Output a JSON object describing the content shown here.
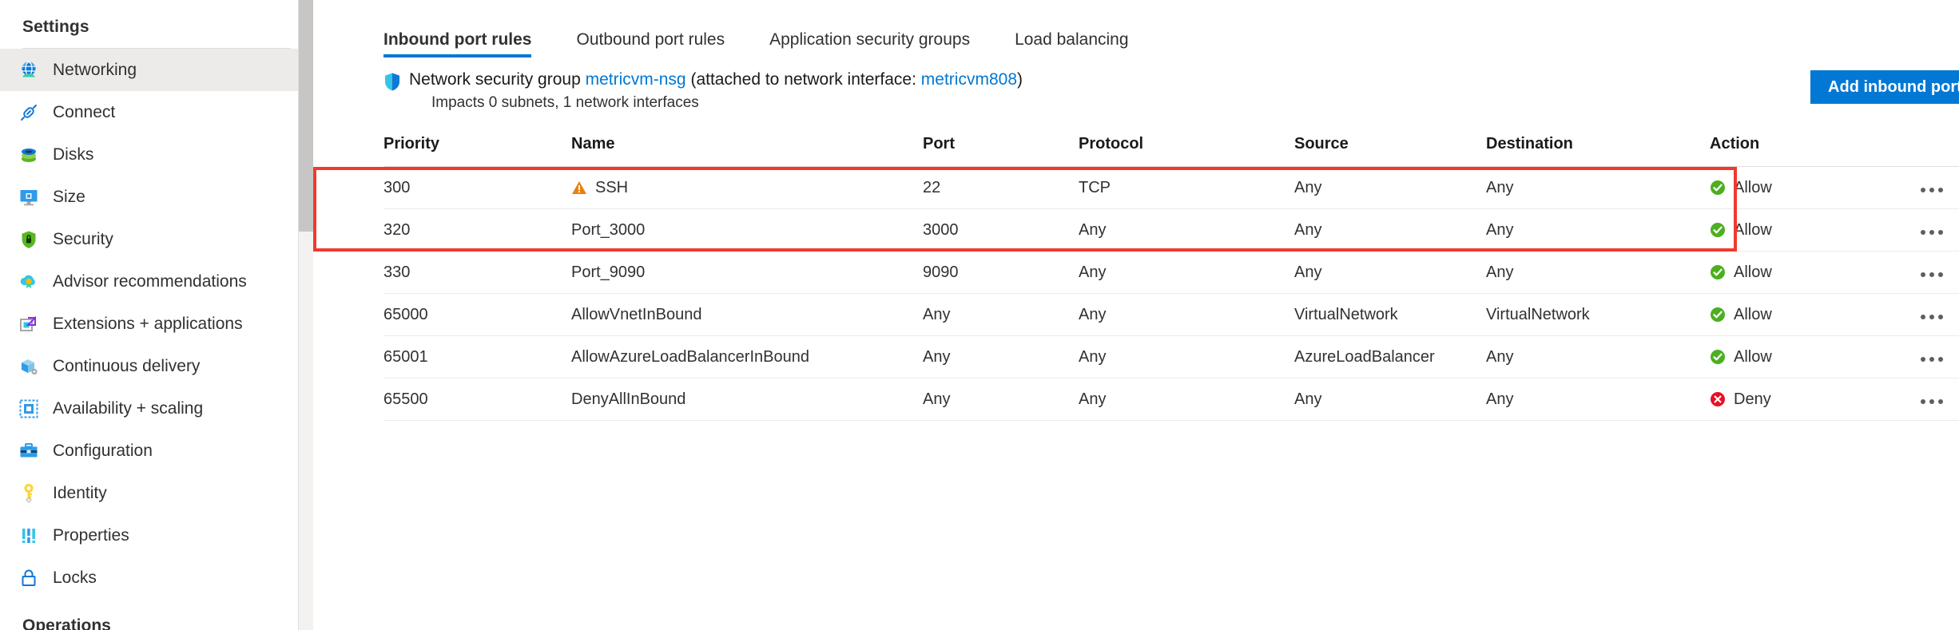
{
  "sidebar": {
    "title": "Settings",
    "items": [
      {
        "label": "Networking",
        "icon": "networking-icon",
        "selected": true
      },
      {
        "label": "Connect",
        "icon": "connect-icon",
        "selected": false
      },
      {
        "label": "Disks",
        "icon": "disks-icon",
        "selected": false
      },
      {
        "label": "Size",
        "icon": "size-icon",
        "selected": false
      },
      {
        "label": "Security",
        "icon": "security-shield-icon",
        "selected": false
      },
      {
        "label": "Advisor recommendations",
        "icon": "advisor-icon",
        "selected": false
      },
      {
        "label": "Extensions + applications",
        "icon": "extensions-icon",
        "selected": false
      },
      {
        "label": "Continuous delivery",
        "icon": "continuous-delivery-icon",
        "selected": false
      },
      {
        "label": "Availability + scaling",
        "icon": "availability-scaling-icon",
        "selected": false
      },
      {
        "label": "Configuration",
        "icon": "configuration-icon",
        "selected": false
      },
      {
        "label": "Identity",
        "icon": "identity-key-icon",
        "selected": false
      },
      {
        "label": "Properties",
        "icon": "properties-icon",
        "selected": false
      },
      {
        "label": "Locks",
        "icon": "lock-icon",
        "selected": false
      }
    ],
    "next_section": "Operations"
  },
  "main": {
    "tabs": [
      {
        "label": "Inbound port rules",
        "active": true
      },
      {
        "label": "Outbound port rules",
        "active": false
      },
      {
        "label": "Application security groups",
        "active": false
      },
      {
        "label": "Load balancing",
        "active": false
      }
    ],
    "nsg": {
      "prefix": "Network security group",
      "name": "metricvm-nsg",
      "attached_prefix": "(attached to network interface:",
      "interface": "metricvm808",
      "attached_suffix": ")",
      "impacts": "Impacts 0 subnets, 1 network interfaces"
    },
    "add_rule_button": "Add inbound port rule",
    "table": {
      "columns": [
        "Priority",
        "Name",
        "Port",
        "Protocol",
        "Source",
        "Destination",
        "Action"
      ],
      "rows": [
        {
          "priority": "300",
          "name": "SSH",
          "warning": true,
          "port": "22",
          "protocol": "TCP",
          "source": "Any",
          "destination": "Any",
          "action": "Allow",
          "action_type": "allow",
          "menu": "more-options"
        },
        {
          "priority": "320",
          "name": "Port_3000",
          "warning": false,
          "port": "3000",
          "protocol": "Any",
          "source": "Any",
          "destination": "Any",
          "action": "Allow",
          "action_type": "allow",
          "menu": "more-options"
        },
        {
          "priority": "330",
          "name": "Port_9090",
          "warning": false,
          "port": "9090",
          "protocol": "Any",
          "source": "Any",
          "destination": "Any",
          "action": "Allow",
          "action_type": "allow",
          "menu": "more-options"
        },
        {
          "priority": "65000",
          "name": "AllowVnetInBound",
          "warning": false,
          "port": "Any",
          "protocol": "Any",
          "source": "VirtualNetwork",
          "destination": "VirtualNetwork",
          "action": "Allow",
          "action_type": "allow",
          "menu": "more-options"
        },
        {
          "priority": "65001",
          "name": "AllowAzureLoadBalancerInBound",
          "warning": false,
          "port": "Any",
          "protocol": "Any",
          "source": "AzureLoadBalancer",
          "destination": "Any",
          "action": "Allow",
          "action_type": "allow",
          "menu": "more-options"
        },
        {
          "priority": "65500",
          "name": "DenyAllInBound",
          "warning": false,
          "port": "Any",
          "protocol": "Any",
          "source": "Any",
          "destination": "Any",
          "action": "Deny",
          "action_type": "deny",
          "menu": "more-options"
        }
      ]
    },
    "annotation": {
      "type": "red-rectangle-highlight",
      "color": "#f03a2e",
      "covers_rows": [
        "320",
        "330"
      ]
    }
  },
  "colors": {
    "accent": "#0078d4",
    "allow": "#4caf21",
    "deny": "#e81123",
    "warning": "#e8820c",
    "highlight": "#f03a2e",
    "selected_bg": "#edebe9"
  }
}
